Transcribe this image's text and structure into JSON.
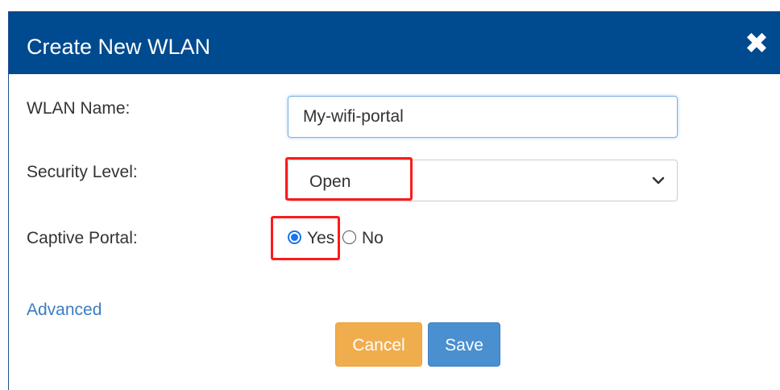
{
  "dialog": {
    "title": "Create New WLAN",
    "close_symbol": "✖"
  },
  "form": {
    "wlan_name": {
      "label": "WLAN Name:",
      "value": "My-wifi-portal"
    },
    "security_level": {
      "label": "Security Level:",
      "selected": "Open"
    },
    "captive_portal": {
      "label": "Captive Portal:",
      "options": [
        {
          "label": "Yes",
          "checked": true
        },
        {
          "label": "No",
          "checked": false
        }
      ]
    },
    "advanced_link": "Advanced"
  },
  "buttons": {
    "cancel": "Cancel",
    "save": "Save"
  },
  "colors": {
    "header_bg": "#004a8f",
    "highlight": "#ff1a1a",
    "link": "#3a7dc2",
    "cancel_bg": "#f0ad4e",
    "save_bg": "#4a8fd0"
  },
  "icons": {
    "close": "close-icon",
    "select_arrow": "chevron-down-icon"
  }
}
